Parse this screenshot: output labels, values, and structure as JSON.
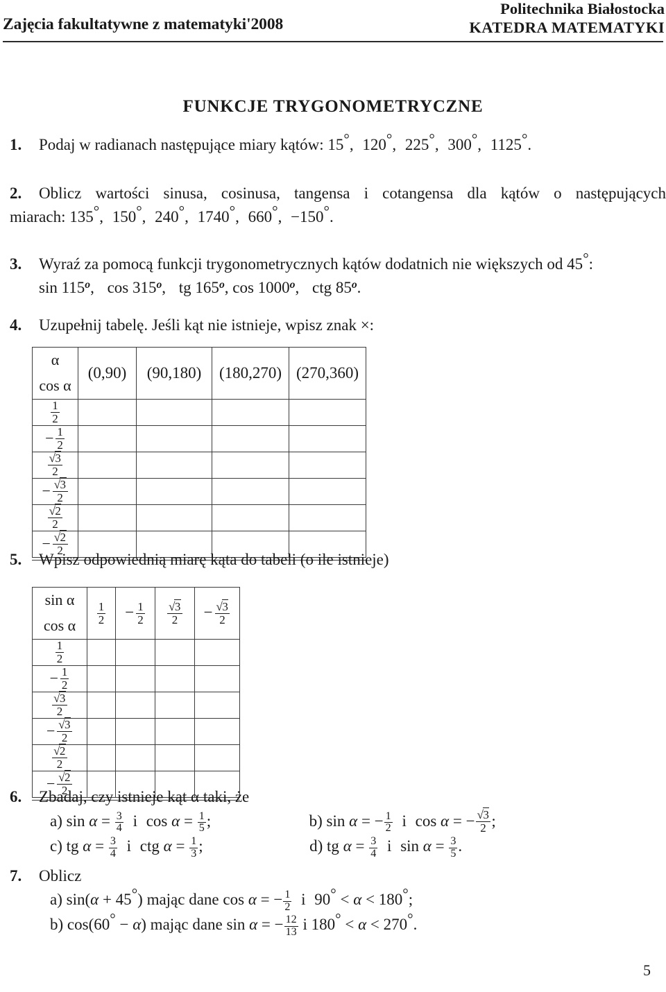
{
  "header": {
    "left": "Zajęcia fakultatywne z matematyki'2008",
    "right_line1": "Politechnika Białostocka",
    "right_line2": "KATEDRA MATEMATYKI"
  },
  "title": "FUNKCJE TRYGONOMETRYCZNE",
  "exercises": {
    "e1": {
      "num": "1.",
      "text": "Podaj w radianach następujące miary kątów: 15°, 120°, 225°, 300°, 1125°."
    },
    "e2": {
      "num": "2.",
      "line1": "Oblicz wartości sinusa, cosinusa, tangensa i cotangensa dla kątów o następujących",
      "line2": "miarach: 135°, 150°, 240°, 1740°, 660°, −150°."
    },
    "e3": {
      "num": "3.",
      "line1": "Wyraź za pomocą funkcji trygonometrycznych kątów dodatnich nie większych od 45°:",
      "line2": "sin 115ᵒ, cos 315ᵒ, tg 165ᵒ, cos 1000ᵒ, ctg 85ᵒ."
    },
    "e4": {
      "num": "4.",
      "text": "Uzupełnij tabelę. Jeśli kąt nie istnieje, wpisz znak ×:"
    },
    "e5": {
      "num": "5.",
      "text": "Wpisz odpowiednią miarę kąta do tabeli (o ile istnieje)"
    },
    "e6": {
      "num": "6.",
      "line1": "Zbadaj, czy istnieje kąt α taki, że",
      "a": "a) sin α = 3/4  i  cos α = 1/5;",
      "b": "b) sin α = −1/2  i  cos α = −√3/2;",
      "c": "c) tg α = 3/4  i  ctg α = 1/3;",
      "d": "d) tg α = 3/4  i  sin α = 3/5."
    },
    "e7": {
      "num": "7.",
      "line1": "Oblicz",
      "a": "a) sin(α + 45°) mając dane cos α = −1/2  i  90° < α < 180°;",
      "b": "b) cos(60° − α) mając dane sin α = −12/13 i 180° < α < 270°."
    }
  },
  "table4": {
    "header_cell_line1": "α",
    "header_cell_line2": "cos α",
    "columns": [
      "(0,90)",
      "(90,180)",
      "(180,270)",
      "(270,360)"
    ],
    "rows": [
      {
        "num": "1",
        "den": "2",
        "neg": false,
        "radicand": ""
      },
      {
        "num": "1",
        "den": "2",
        "neg": true,
        "radicand": ""
      },
      {
        "num": "3",
        "den": "2",
        "neg": false,
        "radicand": "3"
      },
      {
        "num": "3",
        "den": "2",
        "neg": true,
        "radicand": "3"
      },
      {
        "num": "2",
        "den": "2",
        "neg": false,
        "radicand": "2"
      },
      {
        "num": "2",
        "den": "2",
        "neg": true,
        "radicand": "2"
      }
    ]
  },
  "table5": {
    "header_cell_line1": "sin α",
    "header_cell_line2": "cos α",
    "columns": [
      "1/2",
      "−1/2",
      "√3/2",
      "−√3/2"
    ],
    "rows": [
      {
        "num": "1",
        "den": "2",
        "neg": false,
        "radicand": ""
      },
      {
        "num": "1",
        "den": "2",
        "neg": true,
        "radicand": ""
      },
      {
        "num": "3",
        "den": "2",
        "neg": false,
        "radicand": "3"
      },
      {
        "num": "3",
        "den": "2",
        "neg": true,
        "radicand": "3"
      },
      {
        "num": "2",
        "den": "2",
        "neg": false,
        "radicand": "2"
      },
      {
        "num": "2",
        "den": "2",
        "neg": true,
        "radicand": "2"
      }
    ]
  },
  "page_number": "5"
}
